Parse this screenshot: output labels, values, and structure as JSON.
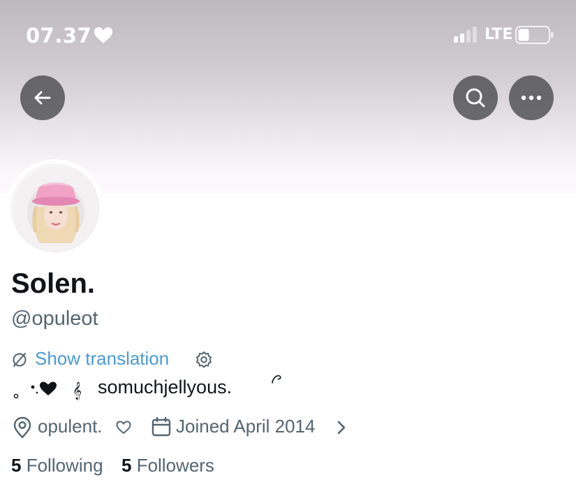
{
  "status_bar": {
    "time": "07.37",
    "network": "LTE",
    "icons": [
      "heart-icon",
      "signal-icon",
      "battery-icon"
    ]
  },
  "nav": {
    "back_icon": "arrow-left-icon",
    "search_icon": "search-icon",
    "more_icon": "more-horizontal-icon"
  },
  "profile": {
    "avatar_icon": "avatar",
    "display_name": "Solen.",
    "handle": "@opuleot",
    "translate_label": "Show translation",
    "bio_text": "somuchjellyous.",
    "location": "opulent.",
    "joined": "Joined April 2014",
    "following_count": "5",
    "following_label": "Following",
    "followers_count": "5",
    "followers_label": "Followers"
  },
  "colors": {
    "link": "#4a9ad2",
    "secondary_text": "#536471",
    "primary_text": "#0f1419",
    "button_bg": "#464648"
  }
}
